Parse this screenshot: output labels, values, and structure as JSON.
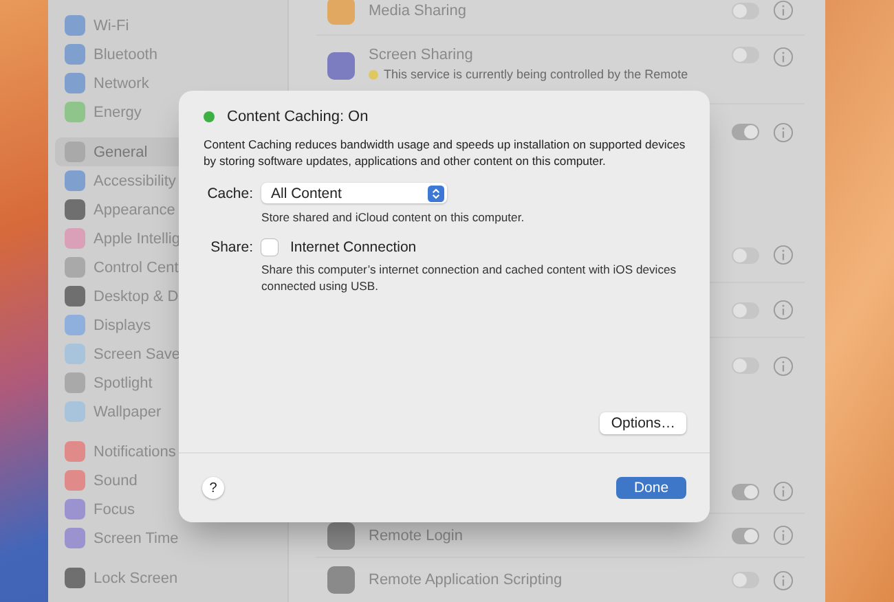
{
  "sidebar": {
    "groups": [
      [
        {
          "label": "Wi-Fi",
          "color": "#7f9fcf",
          "selected": false
        },
        {
          "label": "Bluetooth",
          "color": "#7f9fcf",
          "selected": false
        },
        {
          "label": "Network",
          "color": "#7f9fcf",
          "selected": false
        },
        {
          "label": "Energy",
          "color": "#8fc48a",
          "selected": false
        }
      ],
      [
        {
          "label": "General",
          "color": "#a9a9a9",
          "selected": true
        },
        {
          "label": "Accessibility",
          "color": "#7f9fcf",
          "selected": false
        },
        {
          "label": "Appearance",
          "color": "#6f6f6f",
          "selected": false
        },
        {
          "label": "Apple Intellig",
          "color": "#d9a0b8",
          "selected": false
        },
        {
          "label": "Control Cent",
          "color": "#a9a9a9",
          "selected": false
        },
        {
          "label": "Desktop & D",
          "color": "#6f6f6f",
          "selected": false
        },
        {
          "label": "Displays",
          "color": "#8fb0dc",
          "selected": false
        },
        {
          "label": "Screen Save",
          "color": "#a8c4dc",
          "selected": false
        },
        {
          "label": "Spotlight",
          "color": "#a9a9a9",
          "selected": false
        },
        {
          "label": "Wallpaper",
          "color": "#a8c4dc",
          "selected": false
        }
      ],
      [
        {
          "label": "Notifications",
          "color": "#e08a8a",
          "selected": false
        },
        {
          "label": "Sound",
          "color": "#e08a8a",
          "selected": false
        },
        {
          "label": "Focus",
          "color": "#9a93d0",
          "selected": false
        },
        {
          "label": "Screen Time",
          "color": "#9a93d0",
          "selected": false
        }
      ],
      [
        {
          "label": "Lock Screen",
          "color": "#6f6f6f",
          "selected": false
        }
      ]
    ]
  },
  "services": {
    "groups": [
      [
        {
          "label": "Media Sharing",
          "color": "#e0a860",
          "on": false
        },
        {
          "label": "Screen Sharing",
          "subtitle": "This service is currently being controlled by the Remote",
          "color": "#7c7cc0",
          "on": false
        },
        {
          "on": true
        }
      ],
      [
        {
          "on": false
        },
        {
          "on": false
        },
        {
          "on": false
        }
      ],
      [
        {
          "on": true
        },
        {
          "label": "Remote Login",
          "color": "#8a8a8a",
          "on": true
        },
        {
          "label": "Remote Application Scripting",
          "color": "#8a8a8a",
          "on": false
        }
      ]
    ]
  },
  "dialog": {
    "status": {
      "label": "Content Caching: On",
      "on": true
    },
    "description": "Content Caching reduces bandwidth usage and speeds up installation on supported devices by storing software updates, applications and other content on this computer.",
    "cache": {
      "label": "Cache:",
      "value": "All Content",
      "hint": "Store shared and iCloud content on this computer."
    },
    "share": {
      "label": "Share:",
      "option": "Internet Connection",
      "checked": false,
      "hint": "Share this computer’s internet connection and cached content with iOS devices connected using USB."
    },
    "options_button": "Options…",
    "help_button": "?",
    "done_button": "Done"
  }
}
